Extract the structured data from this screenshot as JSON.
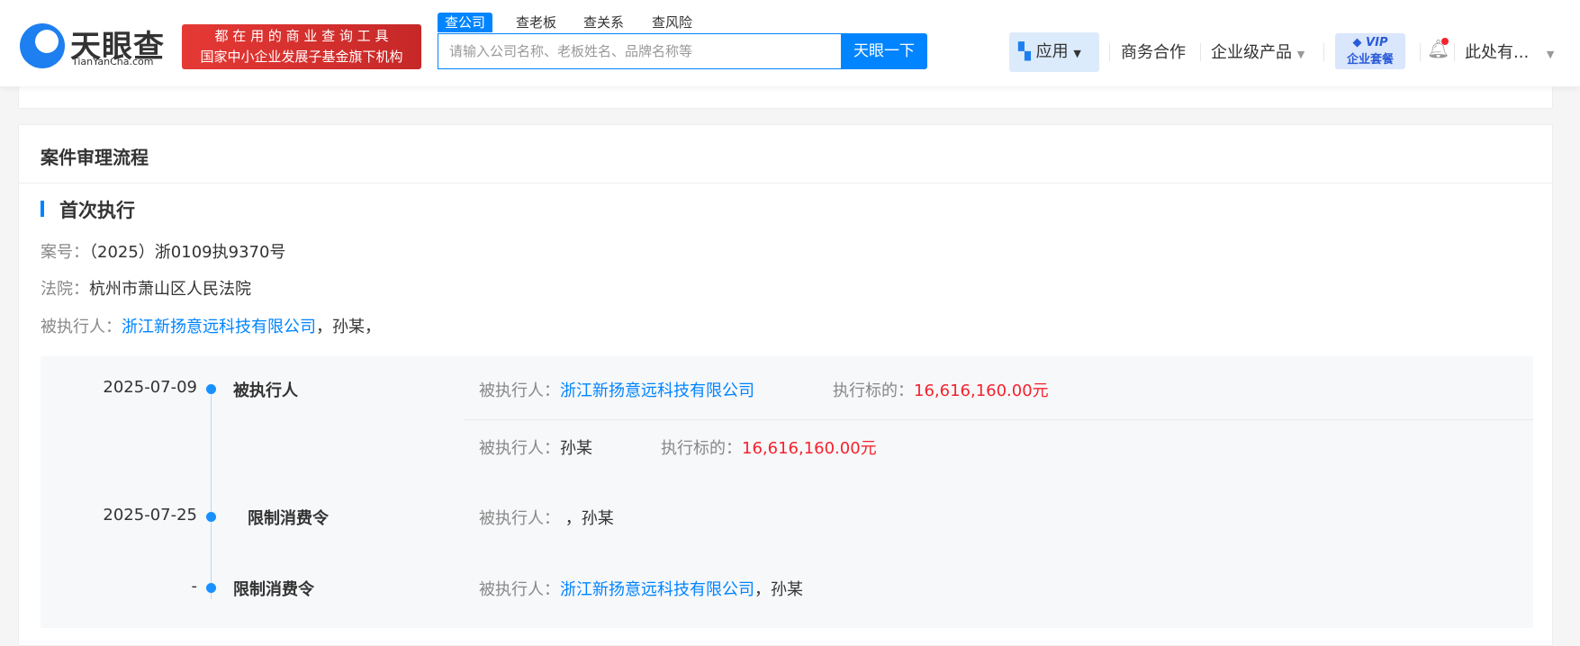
{
  "header": {
    "logo_text": "天眼查",
    "logo_sub": "TianYanCha.com",
    "slogan_1": "都 在 用 的 商 业 查 询 工 具",
    "slogan_2": "国家中小企业发展子基金旗下机构",
    "search_tabs": [
      "查公司",
      "查老板",
      "查关系",
      "查风险"
    ],
    "search_placeholder": "请输入公司名称、老板姓名、品牌名称等",
    "search_button": "天眼一下",
    "nav": {
      "apps": "应用",
      "business": "商务合作",
      "enterprise": "企业级产品",
      "vip_top": "VIP",
      "vip_bottom": "企业套餐",
      "user": "此处有..."
    }
  },
  "section": {
    "title": "案件审理流程",
    "subtitle": "首次执行",
    "case_no_label": "案号：",
    "case_no": "（2025）浙0109执9370号",
    "court_label": "法院：",
    "court": "杭州市萧山区人民法院",
    "party_label": "被执行人：",
    "party_company": "浙江新扬意远科技有限公司",
    "party_rest": "，孙某，"
  },
  "timeline": [
    {
      "date": "2025-07-09",
      "type": "被执行人",
      "entries": [
        {
          "label": "被执行人：",
          "name": "浙江新扬意远科技有限公司",
          "amount_label": "执行标的：",
          "amount": "16,616,160.00元"
        },
        {
          "label": "被执行人：",
          "name": "孙某",
          "amount_label": "执行标的：",
          "amount": "16,616,160.00元"
        }
      ]
    },
    {
      "date": "2025-07-25",
      "type": "限制消费令",
      "label": "被执行人：",
      "text": "，孙某"
    },
    {
      "date": "-",
      "type": "限制消费令",
      "label": "被执行人：",
      "company": "浙江新扬意远科技有限公司",
      "text": "，孙某"
    }
  ],
  "colors": {
    "accent": "#0084ff",
    "amount": "#f5222d",
    "slogan_bg": "#d32f2f"
  }
}
